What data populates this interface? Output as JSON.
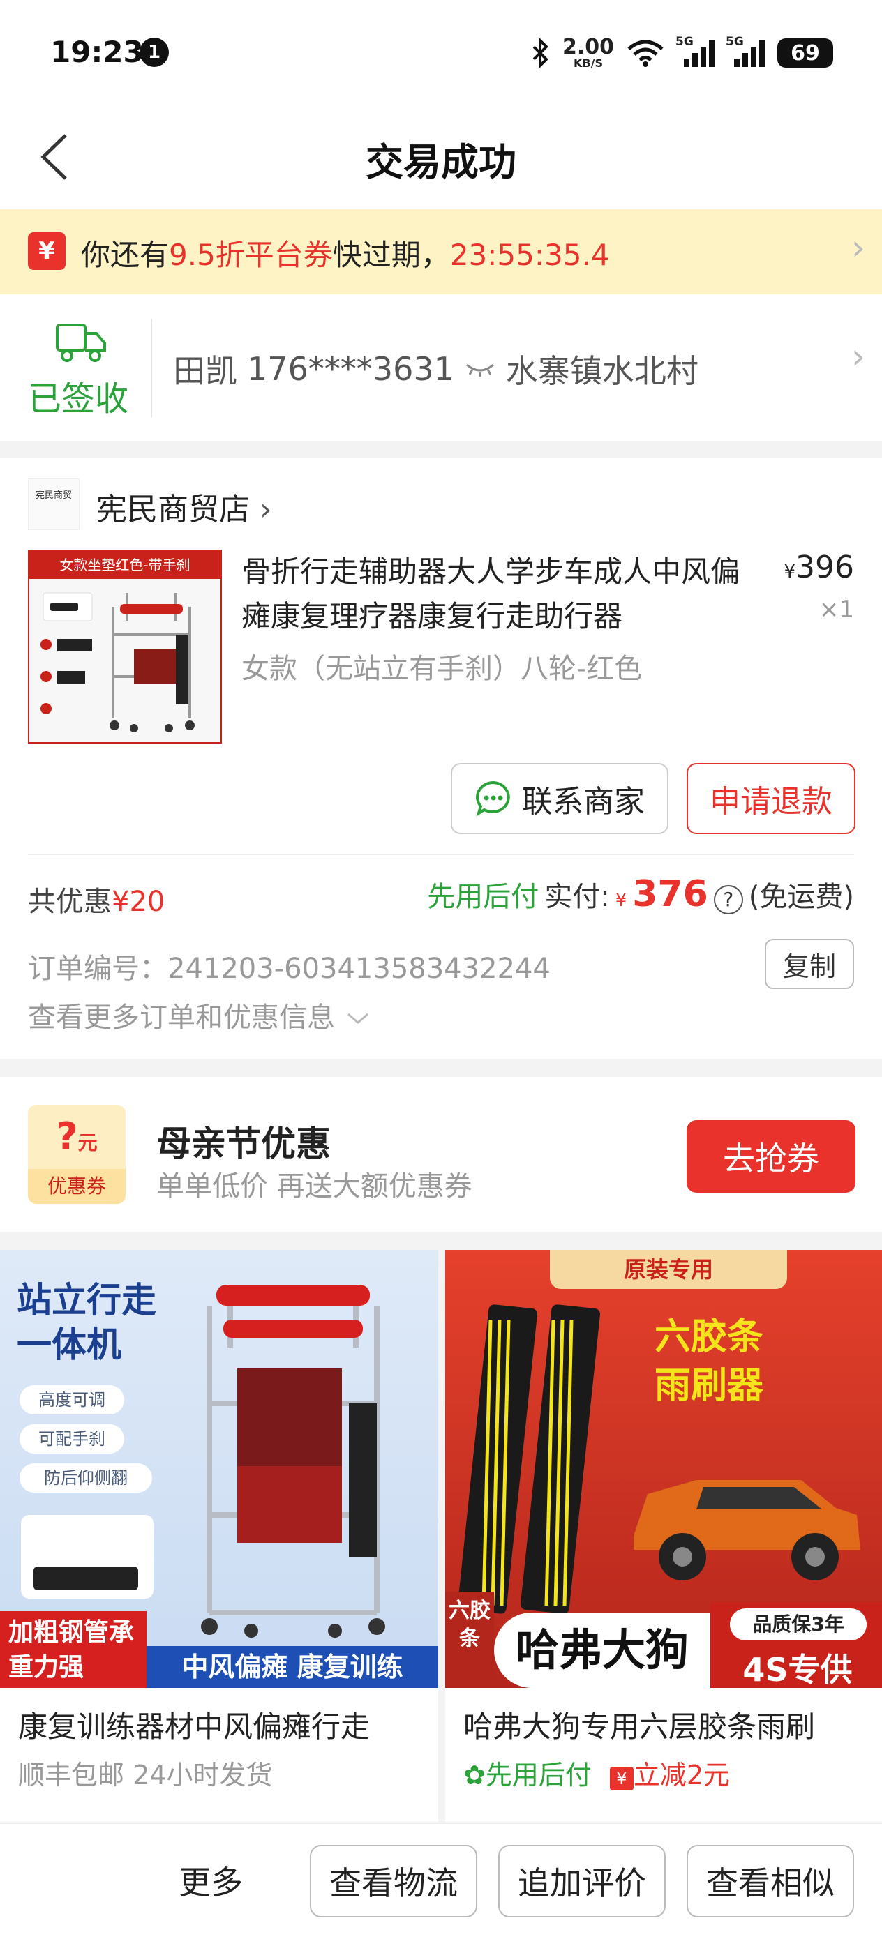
{
  "status_bar": {
    "time": "19:23",
    "notification_count": "1",
    "net_speed_value": "2.00",
    "net_speed_unit": "KB/S",
    "signal1_tag": "5G",
    "signal2_tag": "5G",
    "battery": "69"
  },
  "nav": {
    "title": "交易成功"
  },
  "coupon_banner": {
    "icon_glyph": "¥",
    "text_prefix": "你还有",
    "highlight": "9.5折平台券",
    "text_mid": "快过期，",
    "countdown": "23:55:35.4"
  },
  "delivery": {
    "status": "已签收",
    "recipient_name": "田凯",
    "recipient_phone": "176****3631",
    "address": "水寨镇水北村"
  },
  "order": {
    "shop_logo_text": "宪民商贸",
    "shop_name": "宪民商贸店",
    "product_image_banner": "女款坐垫红色-带手刹",
    "product_title": "骨折行走辅助器大人学步车成人中风偏瘫康复理疗器康复行走助行器",
    "product_spec": "女款（无站立有手刹）八轮-红色",
    "price_symbol": "¥",
    "price": "396",
    "quantity": "×1",
    "contact_label": "联系商家",
    "refund_label": "申请退款",
    "discount_prefix": "共优惠",
    "discount_amount": "¥20",
    "pay_later": "先用后付",
    "paid_label": "实付:",
    "paid_symbol": "¥",
    "paid_amount": "376",
    "shipping_note": "(免运费)",
    "order_number": "订单编号：241203-603413583432244",
    "copy_label": "复制",
    "more_info": "查看更多订单和优惠信息"
  },
  "promo": {
    "icon_top": "?",
    "icon_unit": "元",
    "icon_label": "优惠券",
    "title": "母亲节优惠",
    "subtitle": "单单低价 再送大额优惠券",
    "button": "去抢券"
  },
  "recommendations": [
    {
      "img_headline": "站立行走一体机",
      "img_features": [
        "高度可调",
        "可配手刹",
        "防后仰侧翻"
      ],
      "img_badge_left": "加粗钢管承重力强",
      "img_badge_right": "中风偏瘫 康复训练",
      "title": "康复训练器材中风偏瘫行走",
      "subtitle": "顺丰包邮  24小时发货"
    },
    {
      "img_headline": "六胶条雨刷器",
      "img_top_banner": "原装专用",
      "img_side": "六胶条",
      "img_brand": "哈弗大狗",
      "img_badge": "品质保3年",
      "img_badge2": "4S专供",
      "title": "哈弗大狗专用六层胶条雨刷",
      "tag1": "先用后付",
      "tag2": "立减2元"
    }
  ],
  "bottom_bar": {
    "more": "更多",
    "btn_logistics": "查看物流",
    "btn_review": "追加评价",
    "btn_similar": "查看相似"
  }
}
